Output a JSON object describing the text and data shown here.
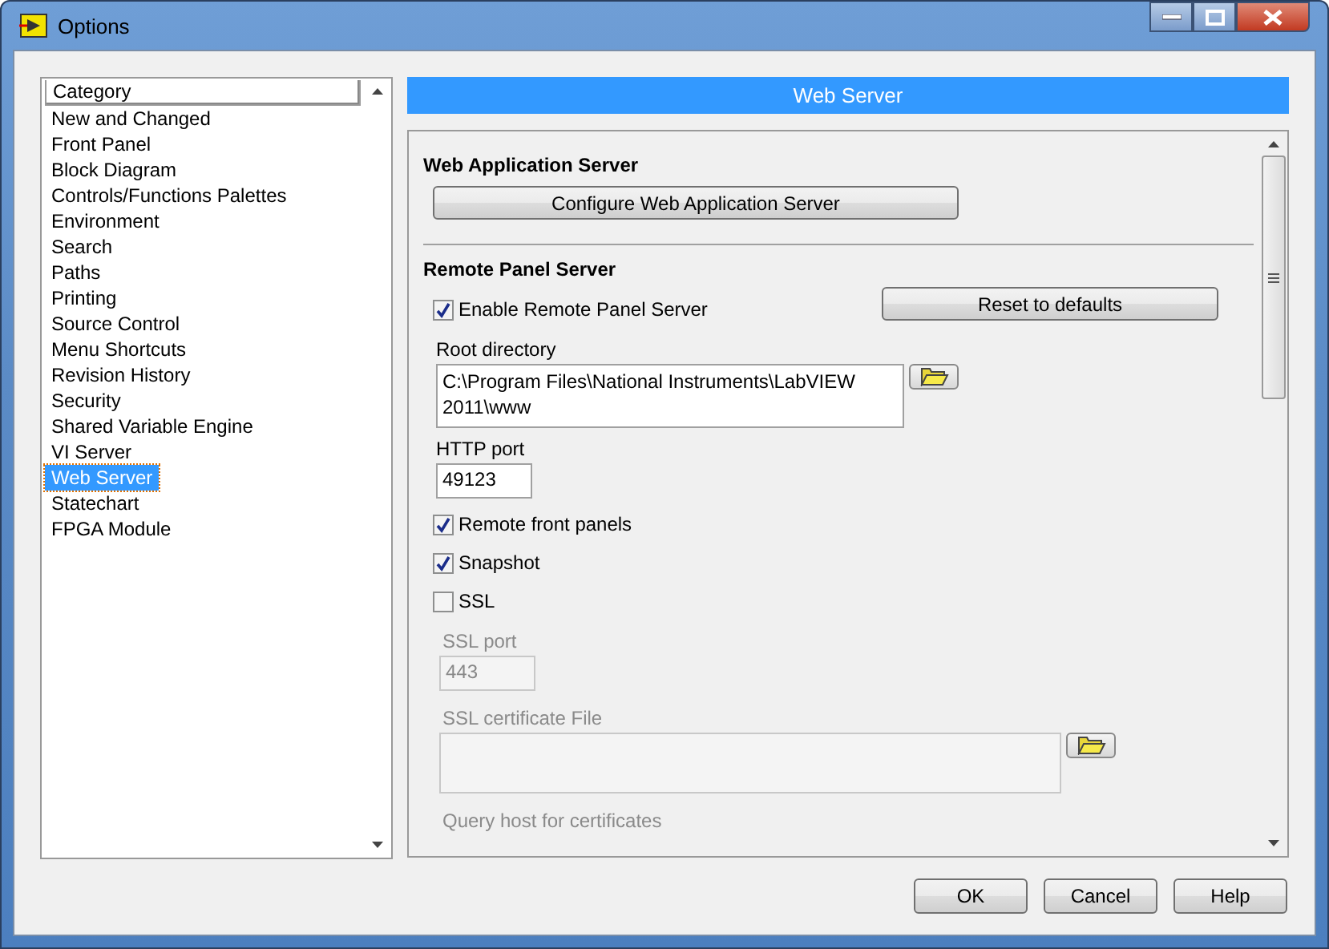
{
  "window": {
    "title": "Options"
  },
  "sidebar": {
    "header": "Category",
    "items": [
      {
        "label": "New and Changed",
        "selected": false
      },
      {
        "label": "Front Panel",
        "selected": false
      },
      {
        "label": "Block Diagram",
        "selected": false
      },
      {
        "label": "Controls/Functions Palettes",
        "selected": false
      },
      {
        "label": "Environment",
        "selected": false
      },
      {
        "label": "Search",
        "selected": false
      },
      {
        "label": "Paths",
        "selected": false
      },
      {
        "label": "Printing",
        "selected": false
      },
      {
        "label": "Source Control",
        "selected": false
      },
      {
        "label": "Menu Shortcuts",
        "selected": false
      },
      {
        "label": "Revision History",
        "selected": false
      },
      {
        "label": "Security",
        "selected": false
      },
      {
        "label": "Shared Variable Engine",
        "selected": false
      },
      {
        "label": "VI Server",
        "selected": false
      },
      {
        "label": "Web Server",
        "selected": true
      },
      {
        "label": "Statechart",
        "selected": false
      },
      {
        "label": "FPGA Module",
        "selected": false
      }
    ]
  },
  "panel": {
    "title": "Web Server",
    "web_application_server": {
      "heading": "Web Application Server",
      "button": "Configure Web Application Server"
    },
    "remote_panel_server": {
      "heading": "Remote Panel Server",
      "enable": {
        "label": "Enable Remote Panel Server",
        "checked": true
      },
      "reset_button": "Reset to defaults",
      "root_directory": {
        "label": "Root directory",
        "value": "C:\\Program Files\\National Instruments\\LabVIEW 2011\\www"
      },
      "http_port": {
        "label": "HTTP port",
        "value": "49123"
      },
      "options": [
        {
          "label": "Remote front panels",
          "checked": true
        },
        {
          "label": "Snapshot",
          "checked": true
        },
        {
          "label": "SSL",
          "checked": false
        }
      ],
      "ssl_port": {
        "label": "SSL port",
        "value": "443",
        "disabled": true
      },
      "ssl_certificate_file": {
        "label": "SSL certificate File",
        "disabled": true
      },
      "query_host": {
        "label": "Query host for certificates",
        "disabled": true
      }
    }
  },
  "buttons": [
    "OK",
    "Cancel",
    "Help"
  ]
}
